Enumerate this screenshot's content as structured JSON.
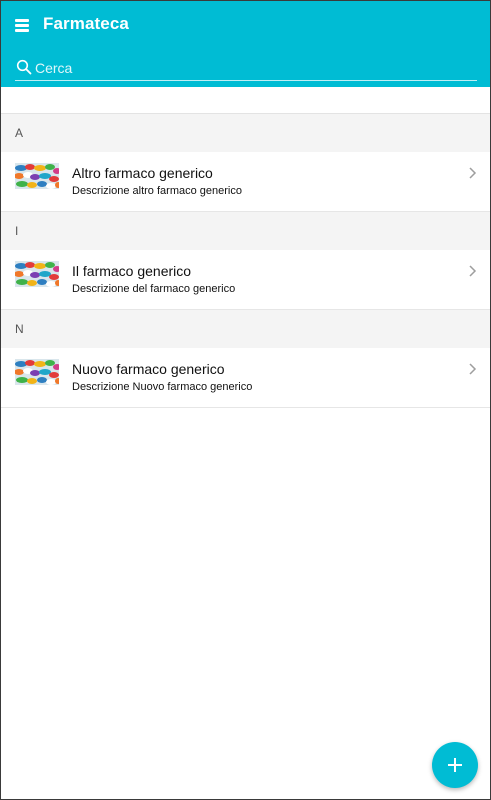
{
  "app": {
    "title": "Farmateca",
    "menu_icon": "hamburger-menu-icon"
  },
  "search": {
    "placeholder": "Cerca",
    "value": "",
    "icon": "search-icon"
  },
  "sections": [
    {
      "letter": "A",
      "items": [
        {
          "title": "Altro farmaco generico",
          "description": "Descrizione altro farmaco generico",
          "thumbnail": "pills-thumbnail",
          "chevron": "chevron-right-icon"
        }
      ]
    },
    {
      "letter": "I",
      "items": [
        {
          "title": "Il farmaco generico",
          "description": "Descrizione del farmaco generico",
          "thumbnail": "pills-thumbnail",
          "chevron": "chevron-right-icon"
        }
      ]
    },
    {
      "letter": "N",
      "items": [
        {
          "title": "Nuovo farmaco generico",
          "description": "Descrizione Nuovo farmaco generico",
          "thumbnail": "pills-thumbnail",
          "chevron": "chevron-right-icon"
        }
      ]
    }
  ],
  "fab": {
    "icon": "plus-icon"
  },
  "colors": {
    "primary": "#00bcd4",
    "section_bg": "#f4f4f4",
    "divider": "#e6e6e6",
    "text": "#111111",
    "chevron": "#9e9e9e"
  }
}
